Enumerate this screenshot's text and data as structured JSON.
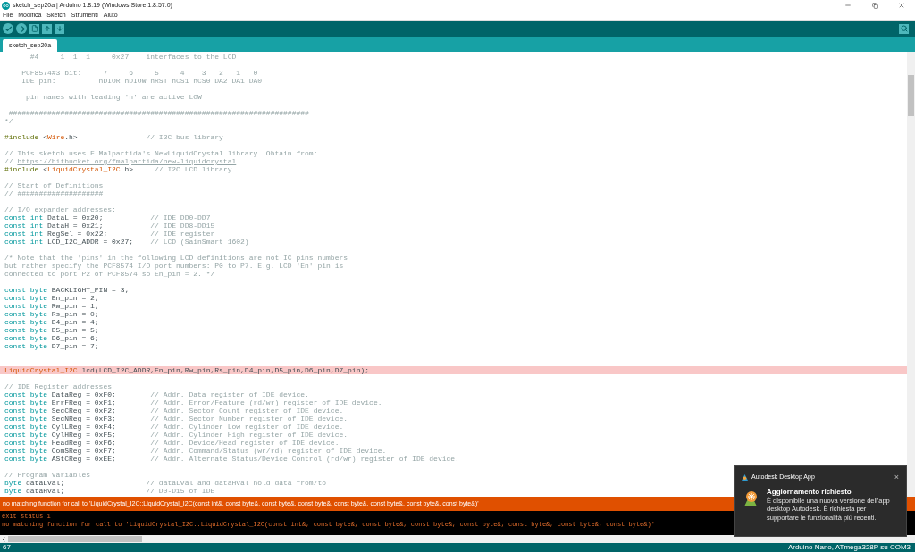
{
  "window": {
    "title": "sketch_sep20a | Arduino 1.8.19 (Windows Store 1.8.57.0)"
  },
  "menu": [
    "File",
    "Modifica",
    "Sketch",
    "Strumenti",
    "Aiuto"
  ],
  "tabs": [
    {
      "label": "sketch_sep20a",
      "selected": true
    }
  ],
  "editor": {
    "lines": [
      {
        "kind": "code",
        "segments": [
          {
            "kind": "comment",
            "text": "      #4     1  1  1     0x27    interfaces to the LCD"
          }
        ]
      },
      {
        "kind": "blank"
      },
      {
        "kind": "code",
        "segments": [
          {
            "kind": "comment",
            "text": "    PCF8574#3 bit:     7     6     5     4    3   2   1   0"
          }
        ]
      },
      {
        "kind": "code",
        "segments": [
          {
            "kind": "comment",
            "text": "    IDE pin:          nDIOR nDIOW nRST nCS1 nCS0 DA2 DA1 DA0"
          }
        ]
      },
      {
        "kind": "blank"
      },
      {
        "kind": "code",
        "segments": [
          {
            "kind": "comment",
            "text": "     pin names with leading 'n' are active LOW"
          }
        ]
      },
      {
        "kind": "blank"
      },
      {
        "kind": "code",
        "segments": [
          {
            "kind": "comment",
            "text": " ######################################################################"
          }
        ]
      },
      {
        "kind": "code",
        "segments": [
          {
            "kind": "comment",
            "text": "*/"
          }
        ]
      },
      {
        "kind": "blank"
      },
      {
        "kind": "code",
        "segments": [
          {
            "kind": "preprocessor",
            "text": "#include "
          },
          {
            "kind": "plain",
            "text": "<"
          },
          {
            "kind": "library",
            "text": "Wire"
          },
          {
            "kind": "plain",
            "text": ".h>                "
          },
          {
            "kind": "comment",
            "text": "// I2C bus library"
          }
        ]
      },
      {
        "kind": "blank"
      },
      {
        "kind": "code",
        "segments": [
          {
            "kind": "comment",
            "text": "// This sketch uses F Malpartida's NewLiquidCrystal library. Obtain from:"
          }
        ]
      },
      {
        "kind": "code",
        "segments": [
          {
            "kind": "comment",
            "text": "// "
          },
          {
            "kind": "link",
            "text": "https://bitbucket.org/fmalpartida/new-liquidcrystal"
          }
        ]
      },
      {
        "kind": "code",
        "segments": [
          {
            "kind": "preprocessor",
            "text": "#include "
          },
          {
            "kind": "plain",
            "text": "<"
          },
          {
            "kind": "library",
            "text": "LiquidCrystal_I2C"
          },
          {
            "kind": "plain",
            "text": ".h>     "
          },
          {
            "kind": "comment",
            "text": "// I2C LCD library"
          }
        ]
      },
      {
        "kind": "blank"
      },
      {
        "kind": "code",
        "segments": [
          {
            "kind": "comment",
            "text": "// Start of Definitions"
          }
        ]
      },
      {
        "kind": "code",
        "segments": [
          {
            "kind": "comment",
            "text": "// ####################"
          }
        ]
      },
      {
        "kind": "blank"
      },
      {
        "kind": "code",
        "segments": [
          {
            "kind": "comment",
            "text": "// I/O expander addresses:"
          }
        ]
      },
      {
        "kind": "code",
        "segments": [
          {
            "kind": "keyword",
            "text": "const int "
          },
          {
            "kind": "plain",
            "text": "DataL = 0x20;           "
          },
          {
            "kind": "comment",
            "text": "// IDE DD0-DD7"
          }
        ]
      },
      {
        "kind": "code",
        "segments": [
          {
            "kind": "keyword",
            "text": "const int "
          },
          {
            "kind": "plain",
            "text": "DataH = 0x21;           "
          },
          {
            "kind": "comment",
            "text": "// IDE DD8-DD15"
          }
        ]
      },
      {
        "kind": "code",
        "segments": [
          {
            "kind": "keyword",
            "text": "const int "
          },
          {
            "kind": "plain",
            "text": "RegSel = 0x22;          "
          },
          {
            "kind": "comment",
            "text": "// IDE register"
          }
        ]
      },
      {
        "kind": "code",
        "segments": [
          {
            "kind": "keyword",
            "text": "const int "
          },
          {
            "kind": "plain",
            "text": "LCD_I2C_ADDR = 0x27;    "
          },
          {
            "kind": "comment",
            "text": "// LCD (SainSmart 1602)"
          }
        ]
      },
      {
        "kind": "blank"
      },
      {
        "kind": "code",
        "segments": [
          {
            "kind": "comment",
            "text": "/* Note that the 'pins' in the following LCD definitions are not IC pins numbers"
          }
        ]
      },
      {
        "kind": "code",
        "segments": [
          {
            "kind": "comment",
            "text": "but rather specify the PCF8574 I/O port numbers: P0 to P7. E.g. LCD 'En' pin is"
          }
        ]
      },
      {
        "kind": "code",
        "segments": [
          {
            "kind": "comment",
            "text": "connected to port P2 of PCF8574 so En_pin = 2. */"
          }
        ]
      },
      {
        "kind": "blank"
      },
      {
        "kind": "code",
        "segments": [
          {
            "kind": "keyword",
            "text": "const byte "
          },
          {
            "kind": "plain",
            "text": "BACKLIGHT_PIN = 3;"
          }
        ]
      },
      {
        "kind": "code",
        "segments": [
          {
            "kind": "keyword",
            "text": "const byte "
          },
          {
            "kind": "plain",
            "text": "En_pin = 2;"
          }
        ]
      },
      {
        "kind": "code",
        "segments": [
          {
            "kind": "keyword",
            "text": "const byte "
          },
          {
            "kind": "plain",
            "text": "Rw_pin = 1;"
          }
        ]
      },
      {
        "kind": "code",
        "segments": [
          {
            "kind": "keyword",
            "text": "const byte "
          },
          {
            "kind": "plain",
            "text": "Rs_pin = 0;"
          }
        ]
      },
      {
        "kind": "code",
        "segments": [
          {
            "kind": "keyword",
            "text": "const byte "
          },
          {
            "kind": "plain",
            "text": "D4_pin = 4;"
          }
        ]
      },
      {
        "kind": "code",
        "segments": [
          {
            "kind": "keyword",
            "text": "const byte "
          },
          {
            "kind": "plain",
            "text": "D5_pin = 5;"
          }
        ]
      },
      {
        "kind": "code",
        "segments": [
          {
            "kind": "keyword",
            "text": "const byte "
          },
          {
            "kind": "plain",
            "text": "D6_pin = 6;"
          }
        ]
      },
      {
        "kind": "code",
        "segments": [
          {
            "kind": "keyword",
            "text": "const byte "
          },
          {
            "kind": "plain",
            "text": "D7_pin = 7;"
          }
        ]
      },
      {
        "kind": "blank"
      },
      {
        "kind": "blank"
      },
      {
        "kind": "error_line",
        "segments": [
          {
            "kind": "library",
            "text": "LiquidCrystal_I2C "
          },
          {
            "kind": "plain",
            "text": "lcd(LCD_I2C_ADDR,En_pin,Rw_pin,Rs_pin,D4_pin,D5_pin,D6_pin,D7_pin);"
          }
        ]
      },
      {
        "kind": "blank"
      },
      {
        "kind": "code",
        "segments": [
          {
            "kind": "comment",
            "text": "// IDE Register addresses"
          }
        ]
      },
      {
        "kind": "code",
        "segments": [
          {
            "kind": "keyword",
            "text": "const byte "
          },
          {
            "kind": "plain",
            "text": "DataReg = 0xF0;        "
          },
          {
            "kind": "comment",
            "text": "// Addr. Data register of IDE device."
          }
        ]
      },
      {
        "kind": "code",
        "segments": [
          {
            "kind": "keyword",
            "text": "const byte "
          },
          {
            "kind": "plain",
            "text": "ErrFReg = 0xF1;        "
          },
          {
            "kind": "comment",
            "text": "// Addr. Error/Feature (rd/wr) register of IDE device."
          }
        ]
      },
      {
        "kind": "code",
        "segments": [
          {
            "kind": "keyword",
            "text": "const byte "
          },
          {
            "kind": "plain",
            "text": "SecCReg = 0xF2;        "
          },
          {
            "kind": "comment",
            "text": "// Addr. Sector Count register of IDE device."
          }
        ]
      },
      {
        "kind": "code",
        "segments": [
          {
            "kind": "keyword",
            "text": "const byte "
          },
          {
            "kind": "plain",
            "text": "SecNReg = 0xF3;        "
          },
          {
            "kind": "comment",
            "text": "// Addr. Sector Number register of IDE device."
          }
        ]
      },
      {
        "kind": "code",
        "segments": [
          {
            "kind": "keyword",
            "text": "const byte "
          },
          {
            "kind": "plain",
            "text": "CylLReg = 0xF4;        "
          },
          {
            "kind": "comment",
            "text": "// Addr. Cylinder Low register of IDE device."
          }
        ]
      },
      {
        "kind": "code",
        "segments": [
          {
            "kind": "keyword",
            "text": "const byte "
          },
          {
            "kind": "plain",
            "text": "CylHReg = 0xF5;        "
          },
          {
            "kind": "comment",
            "text": "// Addr. Cylinder High register of IDE device."
          }
        ]
      },
      {
        "kind": "code",
        "segments": [
          {
            "kind": "keyword",
            "text": "const byte "
          },
          {
            "kind": "plain",
            "text": "HeadReg = 0xF6;        "
          },
          {
            "kind": "comment",
            "text": "// Addr. Device/Head register of IDE device."
          }
        ]
      },
      {
        "kind": "code",
        "segments": [
          {
            "kind": "keyword",
            "text": "const byte "
          },
          {
            "kind": "plain",
            "text": "ComSReg = 0xF7;        "
          },
          {
            "kind": "comment",
            "text": "// Addr. Command/Status (wr/rd) register of IDE device."
          }
        ]
      },
      {
        "kind": "code",
        "segments": [
          {
            "kind": "keyword",
            "text": "const byte "
          },
          {
            "kind": "plain",
            "text": "AStCReg = 0xEE;        "
          },
          {
            "kind": "comment",
            "text": "// Addr. Alternate Status/Device Control (rd/wr) register of IDE device."
          }
        ]
      },
      {
        "kind": "blank"
      },
      {
        "kind": "code",
        "segments": [
          {
            "kind": "comment",
            "text": "// Program Variables"
          }
        ]
      },
      {
        "kind": "code",
        "segments": [
          {
            "kind": "keyword",
            "text": "byte "
          },
          {
            "kind": "plain",
            "text": "dataLval;                   "
          },
          {
            "kind": "comment",
            "text": "// dataLval and dataHval hold data from/to"
          }
        ]
      },
      {
        "kind": "code",
        "segments": [
          {
            "kind": "keyword",
            "text": "byte "
          },
          {
            "kind": "plain",
            "text": "dataHval;                   "
          },
          {
            "kind": "comment",
            "text": "// D0-D15 of IDE"
          }
        ]
      }
    ]
  },
  "message_bar": {
    "text": "no matching function for call to 'LiquidCrystal_I2C::LiquidCrystal_I2C(const int&, const byte&, const byte&, const byte&, const byte&, const byte&, const byte&, const byte&)'"
  },
  "console": {
    "lines": [
      "exit status 1",
      "no matching function for call to 'LiquidCrystal_I2C::LiquidCrystal_I2C(const int&, const byte&, const byte&, const byte&, const byte&, const byte&, const byte&, const byte&)'"
    ]
  },
  "status_bar": {
    "line": "67",
    "board": "Arduino Nano, ATmega328P su COM3"
  },
  "notification": {
    "app": "Autodesk Desktop App",
    "close": "×",
    "title": "Aggiornamento richiesto",
    "body": "È disponibile una nuova versione dell'app desktop Autodesk. È richiesta per supportare le funzionalità più recenti."
  }
}
